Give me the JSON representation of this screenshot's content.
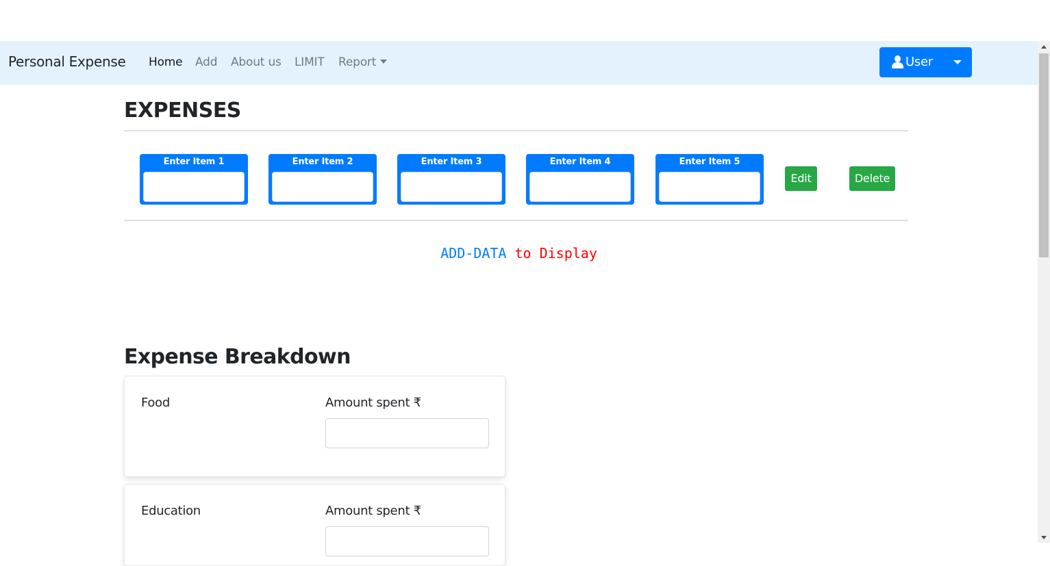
{
  "navbar": {
    "brand": "Personal Expense",
    "links": [
      {
        "label": "Home"
      },
      {
        "label": "Add"
      },
      {
        "label": "About us"
      },
      {
        "label": "LIMIT"
      },
      {
        "label": "Report"
      }
    ],
    "user_button": {
      "label": "User",
      "icon": "user-icon"
    }
  },
  "expenses": {
    "title": "EXPENSES",
    "items": [
      {
        "label": "Enter Item 1",
        "value": ""
      },
      {
        "label": "Enter Item 2",
        "value": ""
      },
      {
        "label": "Enter Item 3",
        "value": ""
      },
      {
        "label": "Enter Item 4",
        "value": ""
      },
      {
        "label": "Enter Item 5",
        "value": ""
      }
    ],
    "edit_label": "Edit",
    "delete_label": "Delete",
    "message": {
      "part1": "ADD-DATA",
      "part2": " to Display"
    }
  },
  "breakdown": {
    "title": "Expense Breakdown",
    "categories": [
      {
        "name": "Food",
        "amount_label": "Amount spent ₹",
        "value": ""
      },
      {
        "name": "Education",
        "amount_label": "Amount spent ₹",
        "value": ""
      }
    ]
  },
  "colors": {
    "navbar_bg": "#e3f2fd",
    "primary": "#007bff",
    "success": "#28a745",
    "message_red": "#ff0000"
  }
}
